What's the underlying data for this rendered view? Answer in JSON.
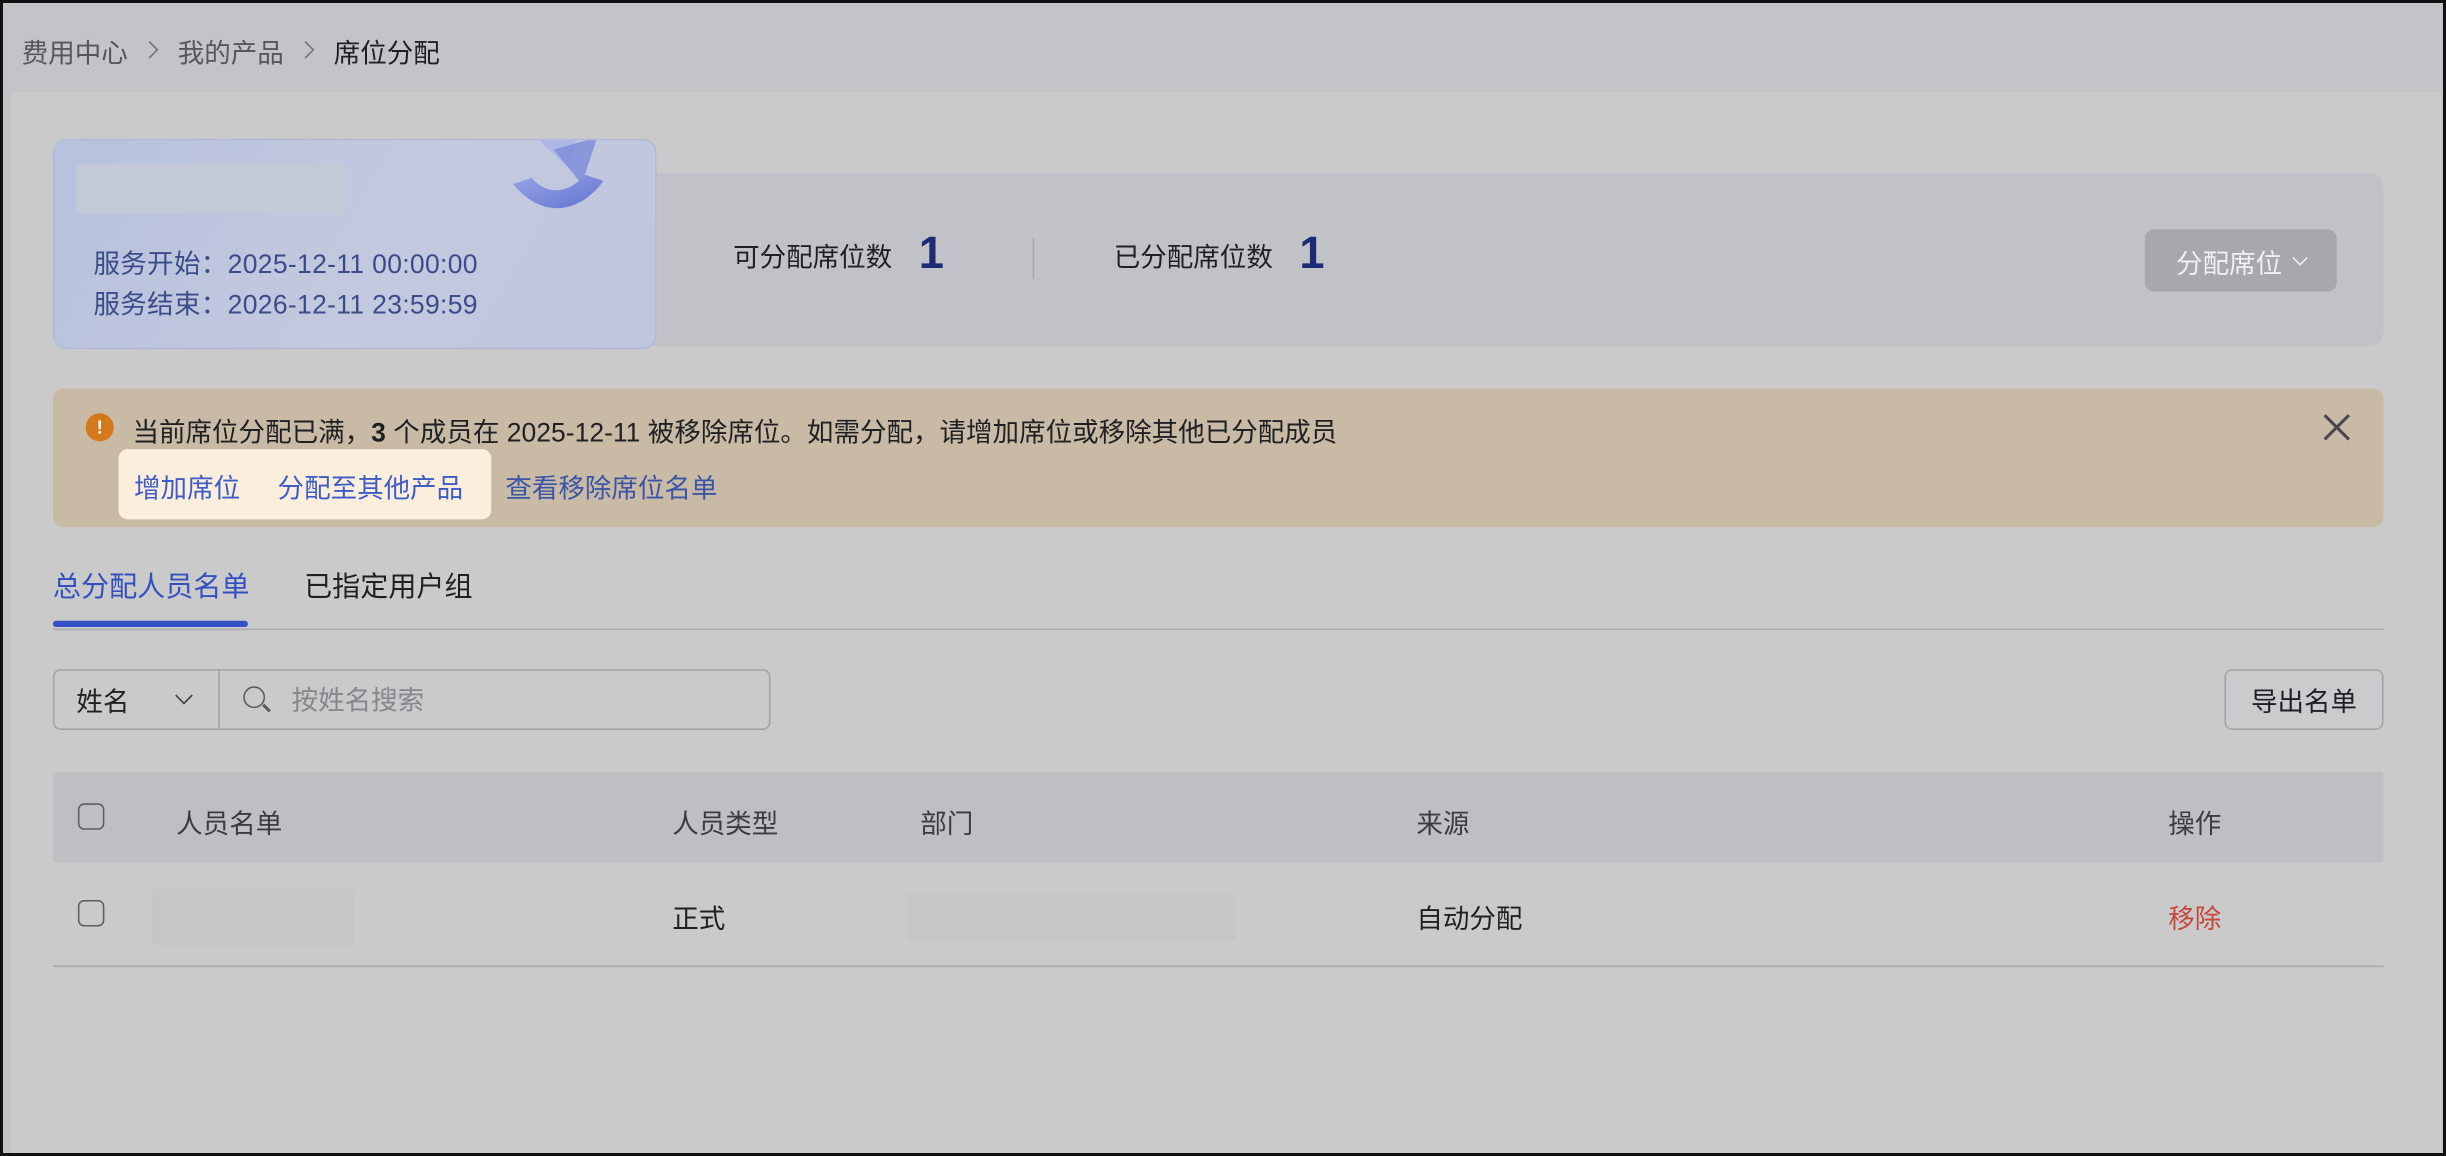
{
  "breadcrumb": {
    "items": [
      {
        "label": "费用中心"
      },
      {
        "label": "我的产品"
      },
      {
        "label": "席位分配"
      }
    ]
  },
  "product": {
    "service_start": "服务开始：2025-12-11 00:00:00",
    "service_end": "服务结束：2026-12-11 23:59:59"
  },
  "stats": {
    "available_label": "可分配席位数",
    "available_value": "1",
    "assigned_label": "已分配席位数",
    "assigned_value": "1"
  },
  "assign_button": {
    "label": "分配席位"
  },
  "alert": {
    "message_prefix": "当前席位分配已满，",
    "message_count": "3",
    "message_suffix": " 个成员在 2025-12-11 被移除席位。如需分配，请增加席位或移除其他已分配成员",
    "links": {
      "add_seats": "增加席位",
      "assign_other": "分配至其他产品",
      "view_removed": "查看移除席位名单"
    }
  },
  "tabs": [
    {
      "label": "总分配人员名单",
      "active": true
    },
    {
      "label": "已指定用户组",
      "active": false
    }
  ],
  "filter": {
    "field_selected": "姓名",
    "search_placeholder": "按姓名搜索"
  },
  "export_button": {
    "label": "导出名单"
  },
  "table": {
    "columns": [
      "人员名单",
      "人员类型",
      "部门",
      "来源",
      "操作"
    ],
    "rows": [
      {
        "type": "正式",
        "source": "自动分配",
        "action": "移除"
      }
    ]
  },
  "colors": {
    "accent": "#3452c5",
    "stat_value": "#1d2b73",
    "alert_bg": "#c9baa5",
    "alert_icon": "#d4781e",
    "danger": "#c5483f"
  },
  "icons": [
    "chevron-right-icon",
    "chevron-down-icon",
    "warning-icon",
    "close-icon",
    "search-icon"
  ]
}
